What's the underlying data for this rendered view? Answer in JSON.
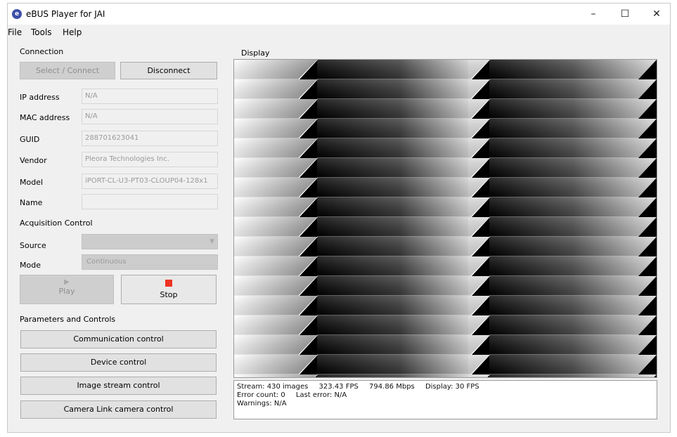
{
  "window": {
    "title": "eBUS Player for JAI",
    "icon": "e",
    "minimize": "–",
    "maximize": "☐",
    "close": "✕"
  },
  "menu": [
    "File",
    "Tools",
    "Help"
  ],
  "connection": {
    "label": "Connection",
    "select_connect": "Select / Connect",
    "disconnect": "Disconnect",
    "fields": [
      {
        "label": "IP address",
        "value": "N/A"
      },
      {
        "label": "MAC address",
        "value": "N/A"
      },
      {
        "label": "GUID",
        "value": "288701623041"
      },
      {
        "label": "Vendor",
        "value": "Pleora Technologies Inc."
      },
      {
        "label": "Model",
        "value": "iPORT-CL-U3-PT03-CLOUP04-128x1"
      },
      {
        "label": "Name",
        "value": ""
      }
    ]
  },
  "acquisition": {
    "label": "Acquisition Control",
    "source_label": "Source",
    "source_value": "",
    "mode_label": "Mode",
    "mode_value": "Continuous",
    "play": "Play",
    "stop": "Stop",
    "stop_color": "#ee3322"
  },
  "parameters": {
    "label": "Parameters and Controls",
    "buttons": [
      "Communication control",
      "Device control",
      "Image stream control",
      "Camera Link camera control"
    ]
  },
  "display": {
    "label": "Display"
  },
  "status": {
    "stream": "Stream: 430 images",
    "fps": "323.43 FPS",
    "mbps": "794.86 Mbps",
    "display_fps": "Display: 30 FPS",
    "error_count": "Error count: 0",
    "last_error": "Last error: N/A",
    "warnings": "Warnings: N/A"
  }
}
